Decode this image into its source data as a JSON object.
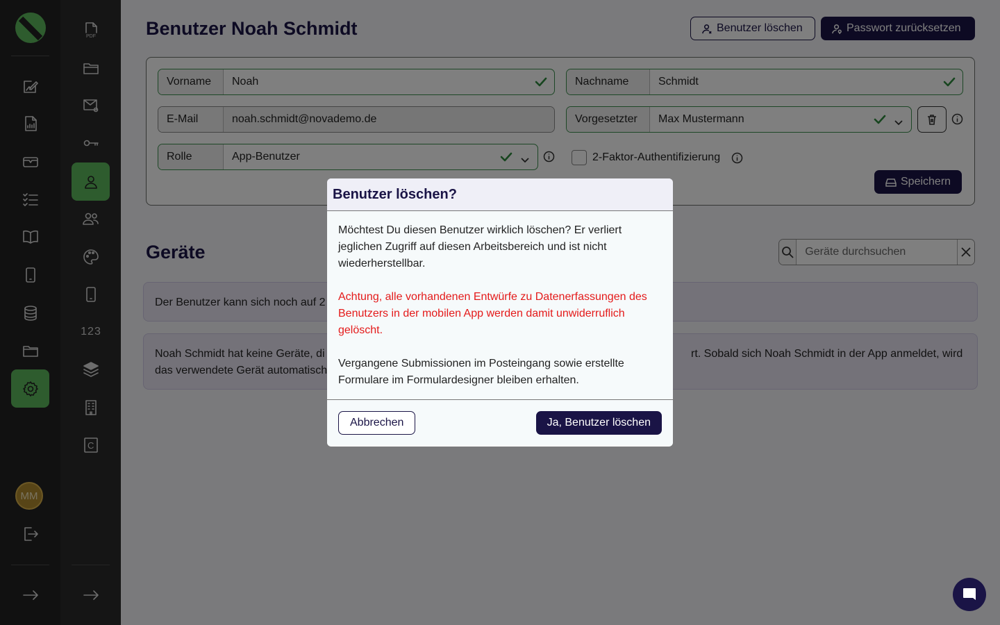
{
  "header": {
    "title": "Benutzer Noah Schmidt",
    "delete_label": "Benutzer löschen",
    "reset_label": "Passwort zurücksetzen"
  },
  "form": {
    "firstname_label": "Vorname",
    "firstname_value": "Noah",
    "lastname_label": "Nachname",
    "lastname_value": "Schmidt",
    "email_label": "E-Mail",
    "email_value": "noah.schmidt@novademo.de",
    "supervisor_label": "Vorgesetzter",
    "supervisor_value": "Max Mustermann",
    "role_label": "Rolle",
    "role_value": "App-Benutzer",
    "twofa_label": "2-Faktor-Authentifizierung",
    "save_label": "Speichern"
  },
  "devices": {
    "title": "Geräte",
    "search_placeholder": "Geräte durchsuchen",
    "info_line1_left": "Der Benutzer kann sich noch auf 2",
    "info_line2_left_a": "Noah Schmidt hat keine Geräte, di",
    "info_line2_right_a": "rt. Sobald sich Noah Schmidt in der App anmeldet, wird",
    "info_line2_left_b": "das verwendete Gerät automatisch"
  },
  "sidebar": {
    "avatar_initials": "MM",
    "numbers_label": "123",
    "c_label": "C"
  },
  "modal": {
    "title": "Benutzer löschen?",
    "p1": "Möchtest Du diesen Benutzer wirklich löschen? Er verliert jeglichen Zugriff auf diesen Arbeitsbereich und ist nicht wiederherstellbar.",
    "p2": "Achtung, alle vorhandenen Entwürfe zu Datenerfassungen des Benutzers in der mobilen App werden damit unwiderruflich gelöscht.",
    "p3": "Vergangene Submissionen im Posteingang sowie erstellte Formulare im Formulardesigner bleiben erhalten.",
    "cancel_label": "Abbrechen",
    "confirm_label": "Ja, Benutzer löschen"
  },
  "colors": {
    "primary": "#1a1446",
    "accent_green": "#5cb85c",
    "warning_red": "#e41a1a"
  }
}
